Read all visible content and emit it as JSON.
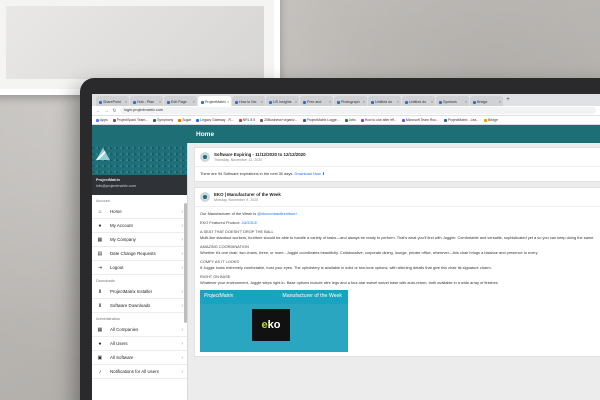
{
  "browser": {
    "tabs": [
      {
        "label": "SharePoint"
      },
      {
        "label": "Hub - Plan"
      },
      {
        "label": "Edit Page"
      },
      {
        "label": "ProjectMatrix"
      },
      {
        "label": "How to Nic"
      },
      {
        "label": "US Insights"
      },
      {
        "label": "Free and"
      },
      {
        "label": "Photograph"
      },
      {
        "label": "Untitled do"
      },
      {
        "label": "Untitled do"
      },
      {
        "label": "Symbols"
      },
      {
        "label": "Bridge"
      }
    ],
    "url": "login.projectmatrix.com",
    "bookmarks": [
      {
        "label": "Apps",
        "color": "#4285f4"
      },
      {
        "label": "ProjectSpark Team...",
        "color": "#5f6368"
      },
      {
        "label": "Symphony",
        "color": "#0b8043"
      },
      {
        "label": "Sugar",
        "color": "#e37400"
      },
      {
        "label": "Legacy Gateway - R...",
        "color": "#1a73e8"
      },
      {
        "label": "NRL 8.5",
        "color": "#d93025"
      },
      {
        "label": "20Business+organiz...",
        "color": "#5f6368"
      },
      {
        "label": "ProjectMatrix Logge...",
        "color": "#1e6e75"
      },
      {
        "label": "Jobs",
        "color": "#188038"
      },
      {
        "label": "How to use after eff...",
        "color": "#9334e6"
      },
      {
        "label": "Microsoft Team Rou...",
        "color": "#5b5fc7"
      },
      {
        "label": "ProjectMatrix - Lea...",
        "color": "#1e6e75"
      },
      {
        "label": "Bridge",
        "color": "#f29900"
      }
    ]
  },
  "header": {
    "title": "Home"
  },
  "sidebar": {
    "user_line1": "ProjectMatrix",
    "user_line2": "info@projectmatrix.com",
    "sections": [
      {
        "label": "Account",
        "items": [
          {
            "label": "Home",
            "icon": "home-icon",
            "glyph": "⌂"
          },
          {
            "label": "My Account",
            "icon": "user-icon",
            "glyph": "●"
          },
          {
            "label": "My Company",
            "icon": "building-icon",
            "glyph": "▦"
          },
          {
            "label": "Date Change Requests",
            "icon": "calendar-icon",
            "glyph": "▤"
          },
          {
            "label": "Logout",
            "icon": "logout-icon",
            "glyph": "⇥"
          }
        ]
      },
      {
        "label": "Downloads",
        "items": [
          {
            "label": "ProjectMatrix Installer",
            "icon": "download-icon",
            "glyph": "⬇"
          },
          {
            "label": "Software Downloads",
            "icon": "download-icon",
            "glyph": "⬇"
          }
        ]
      },
      {
        "label": "Administration",
        "items": [
          {
            "label": "All Companies",
            "icon": "building-icon",
            "glyph": "▦"
          },
          {
            "label": "All Users",
            "icon": "user-icon",
            "glyph": "●"
          },
          {
            "label": "All Software",
            "icon": "box-icon",
            "glyph": "▣"
          },
          {
            "label": "Notifications for All Users",
            "icon": "bell-icon",
            "glyph": "♪"
          }
        ]
      }
    ]
  },
  "feed": {
    "expiring": {
      "title": "Software Expiring - 11/12/2020 to 12/12/2020",
      "date": "Thursday, November 12, 2020",
      "body": "There are 94 Software expirations in the next 30 days.",
      "link": "Download Now ⬇"
    },
    "motw": {
      "title": "EKO | Manufacturer of the Week",
      "date": "Monday, November 9, 2020",
      "intro": "Our Manufacturer of the Week is",
      "handle": "@ekocontractfurniture!",
      "featured_label": "EKO Featured Product:",
      "featured_link": "JUGGLE",
      "h1": "A SEAT THAT DOESN'T DROP THE BALL",
      "p1": "Multi-like standout workers, furniture should be able to handle a variety of tasks—and always be ready to perform. That's what you'll find with Juggler. Comfortable and versatile, sophisticated yet a so you can keep doing the same.",
      "h2": "AMAZING COORDINATION",
      "p2": "Whether it's one chair, two chairs, three, or more...Juggle coordinates beautifully. Collaborative, corporate dining, lounge, private office, wherever—this chair brings a balance and presence to every",
      "h3": "COMFY AS IT LOOKS",
      "p3": "If Juggle looks extremely comfortable, trust your eyes. The upholstery is available in solid or two-tone options, with stitching details that give this chair its signature charm.",
      "h4": "RIGHT ON BASE",
      "p4": "Whatever your environment, Juggle steps right in. Base options include wire legs and a four-star swivel swivel base with auto-return, both available in a wide array of finishes.",
      "banner_brand": "ProjectMatrix",
      "banner_title": "Manufacturer of the Week",
      "banner_logo_e": "e",
      "banner_logo_k": "k",
      "banner_logo_o": "o"
    }
  }
}
